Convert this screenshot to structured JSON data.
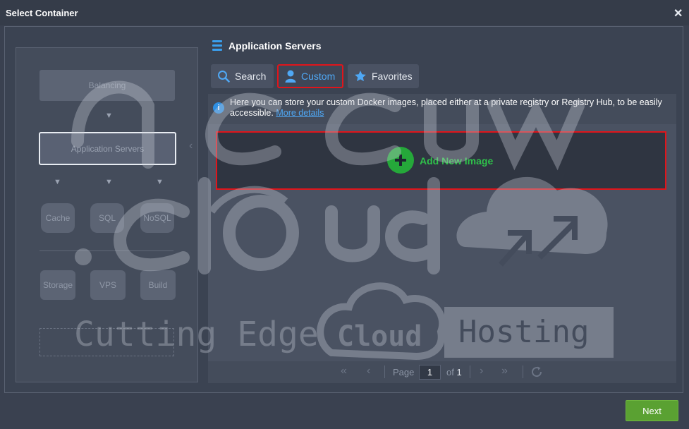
{
  "window": {
    "title": "Select Container"
  },
  "topology": {
    "balancing": "Balancing",
    "app_servers": "Application Servers",
    "cache": "Cache",
    "sql": "SQL",
    "nosql": "NoSQL",
    "storage": "Storage",
    "vps": "VPS",
    "build": "Build"
  },
  "panel": {
    "title": "Application Servers",
    "tabs": [
      {
        "label": "Search",
        "icon": "search-icon"
      },
      {
        "label": "Custom",
        "icon": "user-icon",
        "active": true
      },
      {
        "label": "Favorites",
        "icon": "star-icon"
      }
    ],
    "info_text": "Here you can store your custom Docker images, placed either at a private registry or Registry Hub, to be easily accessible.",
    "info_link": "More details",
    "add_image_label": "Add New Image"
  },
  "pager": {
    "page_label": "Page",
    "current_page": "1",
    "of_label": "of",
    "total_pages": "1"
  },
  "footer": {
    "next_label": "Next"
  },
  "watermark": {
    "line1": "accuweb",
    "line2": ".cloud",
    "tagline_1": "Cutting Edge",
    "tagline_2": "Cloud",
    "tagline_3": "Hosting"
  },
  "colors": {
    "accent": "#3aa0f0",
    "highlight_red": "#e0151b",
    "add_green": "#25a83a",
    "next_green": "#5aa132"
  }
}
